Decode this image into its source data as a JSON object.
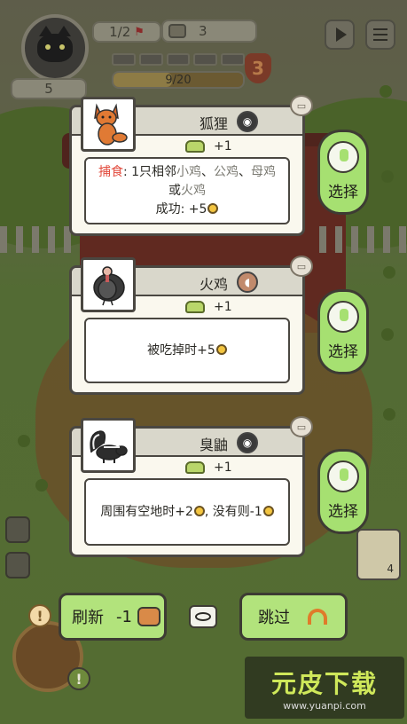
{
  "hud": {
    "level": "1/2",
    "coins": "3",
    "progress_text": "9/20",
    "progress_fraction": 0.45,
    "badge": "3",
    "left_count": "5"
  },
  "cards": [
    {
      "name": "狐狸",
      "type_icon": "wolf-paw-icon",
      "cost": "+1",
      "desc_line1_kw": "捕食",
      "desc_line1_a": ": 1只相邻",
      "desc_line1_b": "小鸡",
      "desc_line1_c": "、",
      "desc_line1_d": "公鸡",
      "desc_line1_e": "、",
      "desc_line1_f": "母鸡",
      "desc_line2_a": "或",
      "desc_line2_b": "火鸡",
      "desc_line3": "成功: +5",
      "portrait": "fox-portrait"
    },
    {
      "name": "火鸡",
      "type_icon": "bird-icon",
      "cost": "+1",
      "desc": "被吃掉时+5",
      "portrait": "turkey-portrait"
    },
    {
      "name": "臭鼬",
      "type_icon": "wolf-paw-icon",
      "cost": "+1",
      "desc": "周围有空地时+2",
      "desc_b": ", 没有则-1",
      "portrait": "skunk-portrait"
    }
  ],
  "choose_label": "选择",
  "refresh_label": "刷新",
  "refresh_cost": "-1",
  "skip_label": "跳过",
  "side_card_count": "4",
  "watermark": {
    "logo": "元皮下载",
    "url": "www.yuanpi.com"
  },
  "colors": {
    "button_green": "#b2e37c",
    "choose_green": "#a6e071",
    "keyword_red": "#e24a3c",
    "card_bg": "#faf8ee"
  }
}
